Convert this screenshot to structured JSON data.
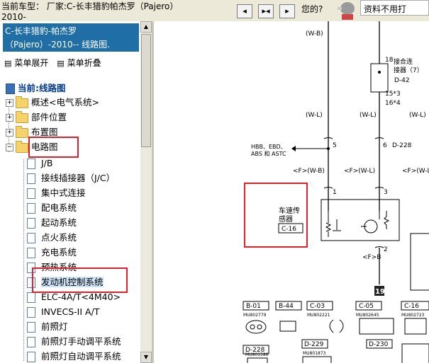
{
  "top_bar": {
    "vehicle_line1": "当前车型：  厂家:C-长丰猎豹帕杰罗（Pajero）",
    "vehicle_line2": "2010-",
    "buttons": [
      "◂",
      "▸◂",
      "▸"
    ],
    "hint": "您的?",
    "notice": "资料不用打"
  },
  "model_box": {
    "line1": "C-长丰猎豹-帕杰罗",
    "line2": "（Pajero）-2010-- 线路图."
  },
  "menu": {
    "expand": "菜单展开",
    "collapse": "菜单折叠"
  },
  "tree": {
    "root": "当前:线路图",
    "folders": [
      "概述<电气系统>",
      "部件位置",
      "布置图",
      "电路图"
    ],
    "items": [
      "J/B",
      "接线插接器（J/C）",
      "集中式连接",
      "配电系统",
      "起动系统",
      "点火系统",
      "充电系统",
      "预热系统",
      "发动机控制系统",
      "ELC-4A/T<4M40>",
      "INVECS-II A/T",
      "前照灯",
      "前照灯手动调平系统",
      "前照灯自动调平系统"
    ]
  },
  "diagram": {
    "labels": {
      "wb_top": "(W-B)",
      "joint_num": "18",
      "joint_name1": "接合连",
      "joint_name2": "接器（7）",
      "joint_code": "D-42",
      "pin15": "15*3",
      "pin16": "16*4",
      "wl1": "(W-L)",
      "wl2": "(W-L)",
      "wl_right": "(W-L)",
      "hbb1": "HBB、EBD、",
      "hbb2": "ABS 和 ASTC",
      "pin5": "5",
      "pin6": "6",
      "d228": "D-228",
      "fwb": "<F>(W-B)",
      "fwl": "<F>(W-L)",
      "fwl_right": "<F>(W-L",
      "pin1": "1",
      "pin3": "3",
      "pin2": "2",
      "sensor1": "车速传",
      "sensor2": "感器",
      "sensor_code": "C-16",
      "fb": "<F>B",
      "ground": "19",
      "conn_labels": [
        "B-01",
        "B-44",
        "C-03",
        "C-05",
        "C-16"
      ],
      "conn_parts": [
        "MU802779",
        "MU802221",
        "MU802645",
        "MU802723"
      ],
      "d_labels": [
        "D-228",
        "D-229",
        "D-230"
      ],
      "d_parts": [
        "MU801586",
        "MU801873"
      ]
    }
  }
}
